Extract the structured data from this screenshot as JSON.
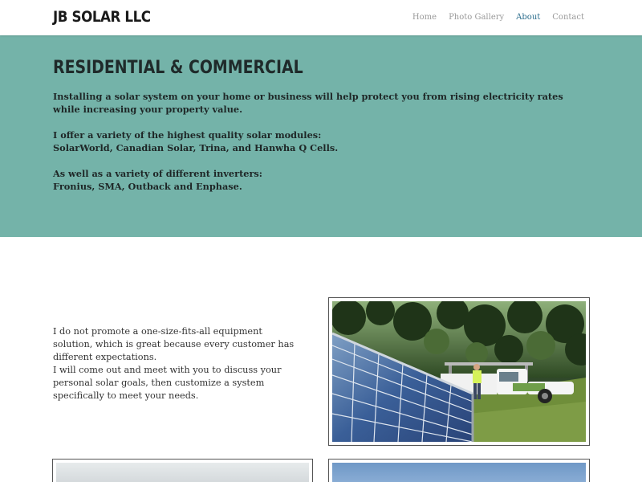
{
  "header": {
    "logo": "JB SOLAR LLC",
    "nav": [
      {
        "label": "Home",
        "active": false
      },
      {
        "label": "Photo Gallery",
        "active": false
      },
      {
        "label": "About",
        "active": true
      },
      {
        "label": "Contact",
        "active": false
      }
    ]
  },
  "hero": {
    "title": "RESIDENTIAL & COMMERCIAL",
    "paragraphs": [
      [
        "Installing a solar system on your home or business will help protect you from rising electricity rates",
        "while increasing your property value."
      ],
      [
        "I offer a variety of the highest quality solar modules:",
        "SolarWorld, Canadian Solar, Trina, and Hanwha Q Cells."
      ],
      [
        "As well as a variety of different inverters:",
        "Fronius, SMA, Outback and Enphase."
      ]
    ]
  },
  "content": {
    "lines": [
      "I do not promote a one-size-fits-all equipment",
      "solution, which is great because every customer has",
      "different expectations.",
      "I will come out and meet with you to discuss your",
      "personal solar goals, then customize a system",
      "specifically to meet your needs."
    ]
  },
  "colors": {
    "band": "#74b3a9",
    "nav_active": "#2e6f8e"
  }
}
